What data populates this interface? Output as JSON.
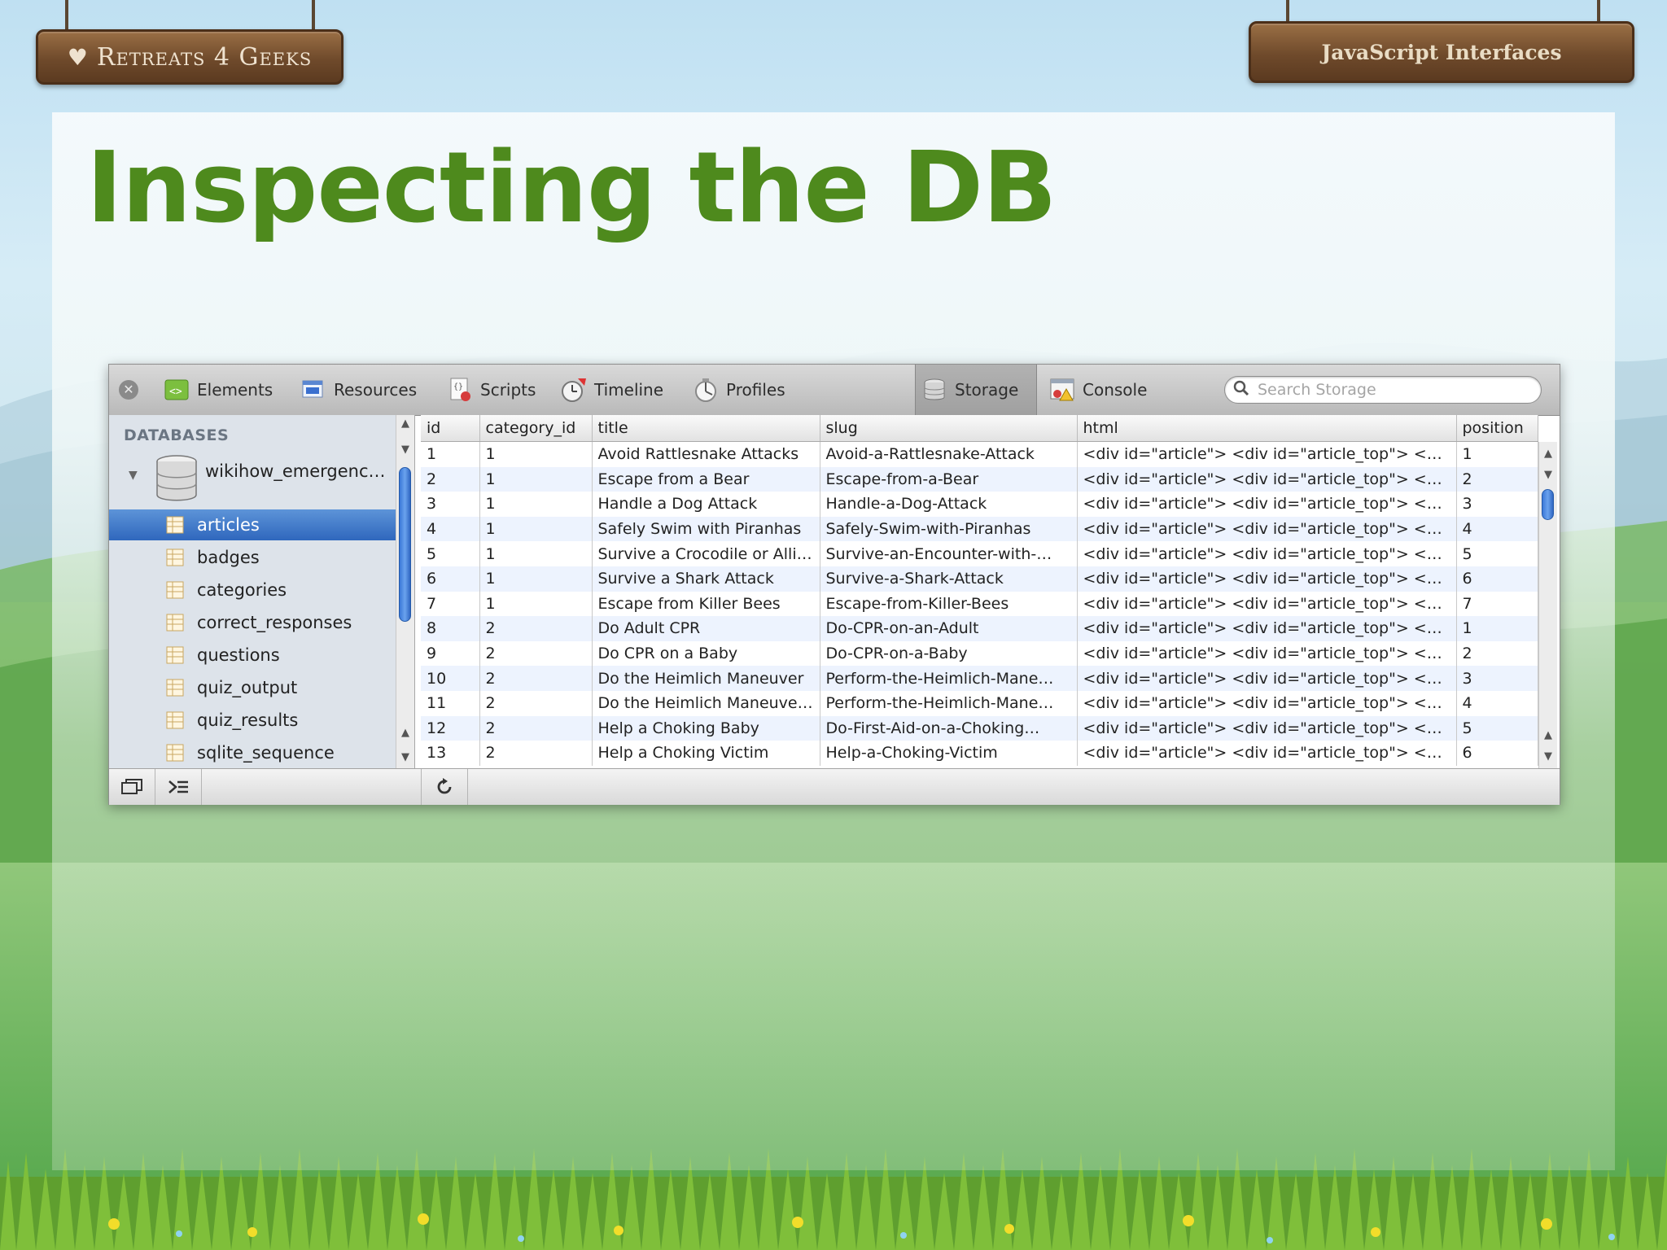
{
  "header": {
    "brand": "Retreats 4 Geeks",
    "course": "JavaScript Interfaces"
  },
  "slide": {
    "title": "Inspecting the DB"
  },
  "inspector": {
    "toolbar": {
      "tabs": [
        {
          "label": "Elements",
          "icon": "elements-icon"
        },
        {
          "label": "Resources",
          "icon": "resources-icon"
        },
        {
          "label": "Scripts",
          "icon": "scripts-icon"
        },
        {
          "label": "Timeline",
          "icon": "timeline-icon"
        },
        {
          "label": "Profiles",
          "icon": "profiles-icon"
        },
        {
          "label": "Storage",
          "icon": "storage-icon",
          "selected": true
        },
        {
          "label": "Console",
          "icon": "console-icon"
        }
      ],
      "search_placeholder": "Search Storage"
    },
    "sidebar": {
      "heading": "DATABASES",
      "database": "wikihow_emergenc…",
      "tables": [
        "articles",
        "badges",
        "categories",
        "correct_responses",
        "questions",
        "quiz_output",
        "quiz_results",
        "sqlite_sequence"
      ],
      "selected": "articles"
    },
    "grid": {
      "columns": [
        "id",
        "category_id",
        "title",
        "slug",
        "html",
        "position"
      ],
      "rows": [
        [
          "1",
          "1",
          "Avoid Rattlesnake Attacks",
          "Avoid-a-Rattlesnake-Attack",
          "<div id=\"article\"> <div id=\"article_top\"> <di…",
          "1"
        ],
        [
          "2",
          "1",
          "Escape from a Bear",
          "Escape-from-a-Bear",
          "<div id=\"article\"> <div id=\"article_top\"> <di…",
          "2"
        ],
        [
          "3",
          "1",
          "Handle a Dog Attack",
          "Handle-a-Dog-Attack",
          "<div id=\"article\"> <div id=\"article_top\"> <di…",
          "3"
        ],
        [
          "4",
          "1",
          "Safely Swim with Piranhas",
          "Safely-Swim-with-Piranhas",
          "<div id=\"article\"> <div id=\"article_top\"> <di…",
          "4"
        ],
        [
          "5",
          "1",
          "Survive a Crocodile or Alli…",
          "Survive-an-Encounter-with-…",
          "<div id=\"article\"> <div id=\"article_top\"> <di…",
          "5"
        ],
        [
          "6",
          "1",
          "Survive a Shark Attack",
          "Survive-a-Shark-Attack",
          "<div id=\"article\"> <div id=\"article_top\"> <di…",
          "6"
        ],
        [
          "7",
          "1",
          "Escape from Killer Bees",
          "Escape-from-Killer-Bees",
          "<div id=\"article\"> <div id=\"article_top\"> <di…",
          "7"
        ],
        [
          "8",
          "2",
          "Do Adult CPR",
          "Do-CPR-on-an-Adult",
          "<div id=\"article\"> <div id=\"article_top\"> <di…",
          "1"
        ],
        [
          "9",
          "2",
          "Do CPR on a Baby",
          "Do-CPR-on-a-Baby",
          "<div id=\"article\"> <div id=\"article_top\"> <di…",
          "2"
        ],
        [
          "10",
          "2",
          "Do the Heimlich Maneuver",
          "Perform-the-Heimlich-Mane…",
          "<div id=\"article\"> <div id=\"article_top\"> <di…",
          "3"
        ],
        [
          "11",
          "2",
          "Do the Heimlich Maneuve…",
          "Perform-the-Heimlich-Mane…",
          "<div id=\"article\"> <div id=\"article_top\"> <di…",
          "4"
        ],
        [
          "12",
          "2",
          "Help a Choking Baby",
          "Do-First-Aid-on-a-Choking…",
          "<div id=\"article\"> <div id=\"article_top\"> <di…",
          "5"
        ],
        [
          "13",
          "2",
          "Help a Choking Victim",
          "Help-a-Choking-Victim",
          "<div id=\"article\"> <div id=\"article_top\"> <di…",
          "6"
        ]
      ]
    },
    "statusbar": {
      "buttons": [
        "undock-icon",
        "console-toggle-icon",
        "refresh-icon"
      ]
    }
  },
  "colors": {
    "title_green": "#4e8a1d",
    "selection_blue": "#2f67bd",
    "wood": "#6f4a2b"
  }
}
